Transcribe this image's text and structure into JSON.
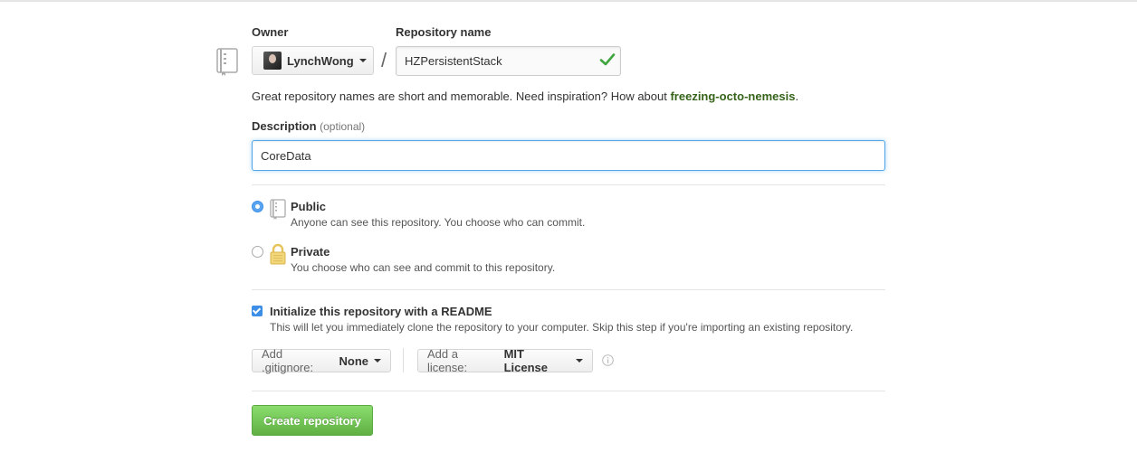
{
  "owner": {
    "label": "Owner",
    "selected": "LynchWong"
  },
  "repository_name": {
    "label": "Repository name",
    "value": "HZPersistentStack",
    "separator": "/"
  },
  "name_hint": {
    "text": "Great repository names are short and memorable. Need inspiration? How about ",
    "suggestion": "freezing-octo-nemesis",
    "suffix": "."
  },
  "description": {
    "label": "Description",
    "optional_note": "(optional)",
    "value": "CoreData"
  },
  "visibility": {
    "selected": "public",
    "public": {
      "title": "Public",
      "note": "Anyone can see this repository. You choose who can commit."
    },
    "private": {
      "title": "Private",
      "note": "You choose who can see and commit to this repository."
    }
  },
  "readme": {
    "checked": true,
    "title": "Initialize this repository with a README",
    "note": "This will let you immediately clone the repository to your computer. Skip this step if you're importing an existing repository."
  },
  "gitignore": {
    "prefix": "Add .gitignore:",
    "value": "None"
  },
  "license": {
    "prefix": "Add a license:",
    "value": "MIT License"
  },
  "create_button": {
    "label": "Create repository"
  },
  "colors": {
    "suggestion_green": "#36631a",
    "focus_blue": "#51a7e8",
    "button_green": "#60b044",
    "check_green": "#3fa63f"
  }
}
